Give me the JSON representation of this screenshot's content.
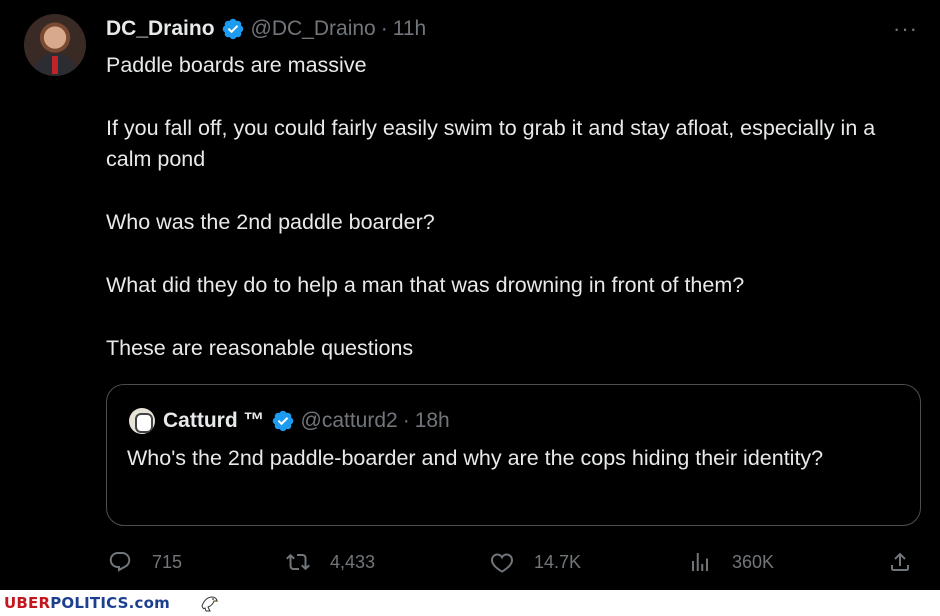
{
  "tweet": {
    "author_name": "DC_Draino",
    "author_handle": "@DC_Draino",
    "separator": "·",
    "time": "11h",
    "more_label": "···",
    "paragraphs": [
      "Paddle boards are massive",
      "If you fall off, you could fairly easily swim to grab it and stay afloat, especially in a calm pond",
      "Who was the 2nd paddle boarder?",
      "What did they do to help a man that was drowning in front of them?",
      "These are reasonable questions"
    ]
  },
  "quote": {
    "author_name": "Catturd ™",
    "author_handle": "@catturd2",
    "separator": "·",
    "time": "18h",
    "text": "Who's the 2nd paddle-boarder and why are the cops hiding their identity?"
  },
  "actions": {
    "replies": "715",
    "reposts": "4,433",
    "likes": "14.7K",
    "views": "360K"
  },
  "icons": {
    "verified": "verified-badge-icon",
    "reply": "reply-icon",
    "repost": "repost-icon",
    "like": "heart-icon",
    "views": "views-icon",
    "share": "share-icon"
  },
  "colors": {
    "background": "#000000",
    "text": "#e7e9ea",
    "muted": "#71767b",
    "verified": "#1d9bf0",
    "brand_red": "#c4161c",
    "brand_blue": "#1d3f8f"
  },
  "watermark": {
    "part1": "UBER",
    "part2": "POLITICS.com"
  }
}
